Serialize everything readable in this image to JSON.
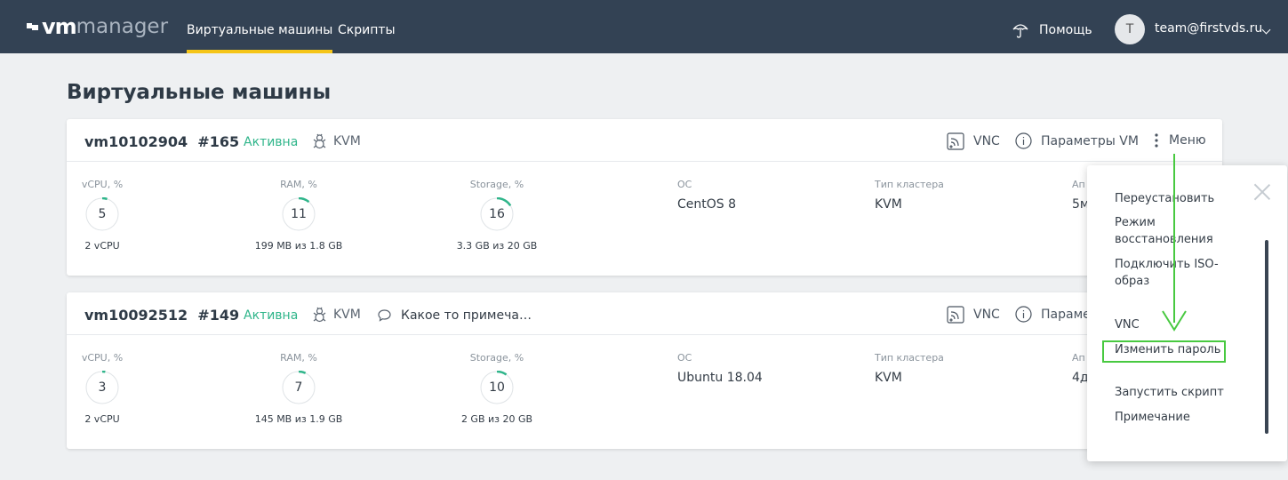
{
  "header": {
    "logo_vm": "vm",
    "logo_manager": "manager",
    "nav": [
      {
        "label": "Виртуальные машины",
        "active": true
      },
      {
        "label": "Скрипты",
        "active": false
      }
    ],
    "help_label": "Помощь",
    "avatar_initial": "T",
    "user_email": "team@firstvds.ru"
  },
  "page_title": "Виртуальные машины",
  "vms": [
    {
      "name": "vm10102904  #165",
      "status": "Активна",
      "type": "KVM",
      "note": "",
      "actions": {
        "vnc": "VNC",
        "params": "Параметры VM",
        "menu": "Меню"
      },
      "metrics": [
        {
          "label": "vCPU, %",
          "value": "5",
          "percent": 5,
          "sub": "2 vCPU"
        },
        {
          "label": "RAM, %",
          "value": "11",
          "percent": 11,
          "sub": "199 MB из 1.8 GB"
        },
        {
          "label": "Storage, %",
          "value": "16",
          "percent": 16,
          "sub": "3.3 GB из 20 GB"
        }
      ],
      "fields": [
        {
          "label": "ОС",
          "value": "CentOS 8"
        },
        {
          "label": "Тип кластера",
          "value": "KVM"
        },
        {
          "label": "Ап",
          "value": "5м"
        }
      ]
    },
    {
      "name": "vm10092512  #149",
      "status": "Активна",
      "type": "KVM",
      "note": "Какое то примеча…",
      "actions": {
        "vnc": "VNC",
        "params": "Параме",
        "menu": ""
      },
      "metrics": [
        {
          "label": "vCPU, %",
          "value": "3",
          "percent": 3,
          "sub": "2 vCPU"
        },
        {
          "label": "RAM, %",
          "value": "7",
          "percent": 7,
          "sub": "145 MB из 1.9 GB"
        },
        {
          "label": "Storage, %",
          "value": "10",
          "percent": 10,
          "sub": "2 GB из 20 GB"
        }
      ],
      "fields": [
        {
          "label": "ОС",
          "value": "Ubuntu 18.04"
        },
        {
          "label": "Тип кластера",
          "value": "KVM"
        },
        {
          "label": "Ап",
          "value": "4д"
        }
      ]
    }
  ],
  "dropdown": {
    "items": [
      "Переустановить",
      "Режим восстановления",
      "Подключить ISO-образ",
      "VNC",
      "Изменить пароль",
      "Запустить скрипт",
      "Примечание"
    ],
    "highlighted": "Изменить пароль"
  },
  "colors": {
    "topbar": "#334254",
    "active_underline": "#f5c518",
    "status": "#2fb58a",
    "highlight": "#48c940"
  }
}
